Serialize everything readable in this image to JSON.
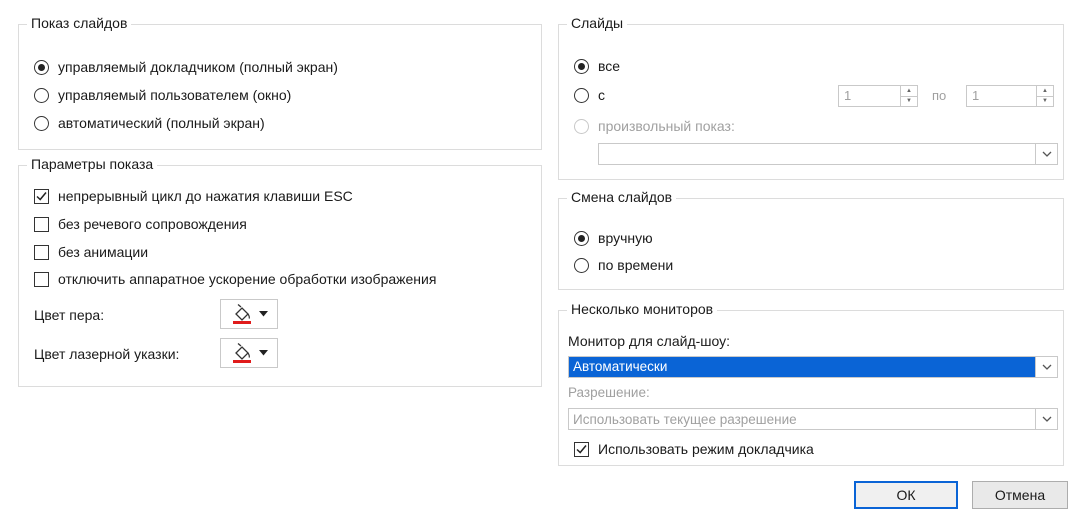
{
  "show_type": {
    "title": "Показ слайдов",
    "options": [
      {
        "label": "управляемый докладчиком (полный экран)",
        "selected": true
      },
      {
        "label": "управляемый пользователем (окно)",
        "selected": false
      },
      {
        "label": "автоматический (полный экран)",
        "selected": false
      }
    ]
  },
  "show_options": {
    "title": "Параметры показа",
    "checks": [
      {
        "label": "непрерывный цикл до нажатия клавиши ESC",
        "checked": true
      },
      {
        "label": "без речевого сопровождения",
        "checked": false
      },
      {
        "label": "без анимации",
        "checked": false
      },
      {
        "label": "отключить аппаратное ускорение обработки изображения",
        "checked": false
      }
    ],
    "pen_color_label": "Цвет пера:",
    "laser_color_label": "Цвет лазерной указки:",
    "pen_color": "#e01b1b",
    "laser_color": "#e01b1b"
  },
  "slides": {
    "title": "Слайды",
    "all_label": "все",
    "from_label": "с",
    "from_value": "1",
    "to_label": "по",
    "to_value": "1",
    "custom_label": "произвольный показ:",
    "custom_value": ""
  },
  "advance": {
    "title": "Смена слайдов",
    "options": [
      {
        "label": "вручную",
        "selected": true
      },
      {
        "label": "по времени",
        "selected": false
      }
    ]
  },
  "monitors": {
    "title": "Несколько мониторов",
    "monitor_label": "Монитор для слайд-шоу:",
    "monitor_value": "Автоматически",
    "resolution_label": "Разрешение:",
    "resolution_value": "Использовать текущее разрешение",
    "presenter_view_label": "Использовать режим докладчика",
    "presenter_view_checked": true
  },
  "buttons": {
    "ok": "ОК",
    "cancel": "Отмена"
  },
  "icons": {
    "fill_bucket": "paint-bucket-icon",
    "dropdown": "chevron-down-icon",
    "spin_up": "spin-up-icon",
    "spin_down": "spin-down-icon"
  },
  "colors": {
    "accent": "#0a64d6"
  }
}
